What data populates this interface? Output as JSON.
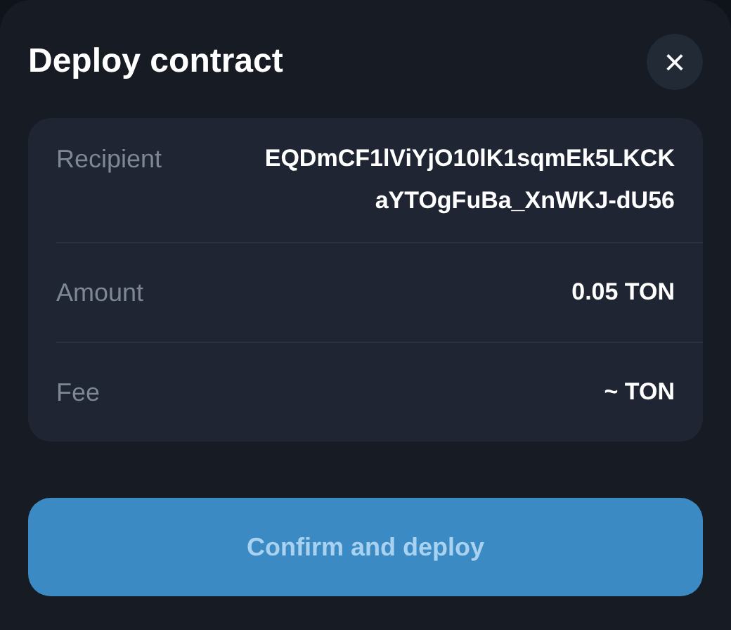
{
  "dialog": {
    "title": "Deploy contract",
    "close_label": "×"
  },
  "details": [
    {
      "label": "Recipient",
      "value": "EQDmCF1lViYjO10lK1sqmEk5LKCKaYTOgFuBa_XnWKJ-dU56"
    },
    {
      "label": "Amount",
      "value": "0.05 TON"
    },
    {
      "label": "Fee",
      "value": "~ TON"
    }
  ],
  "confirm_button": {
    "label": "Confirm and deploy",
    "disabled": true
  }
}
